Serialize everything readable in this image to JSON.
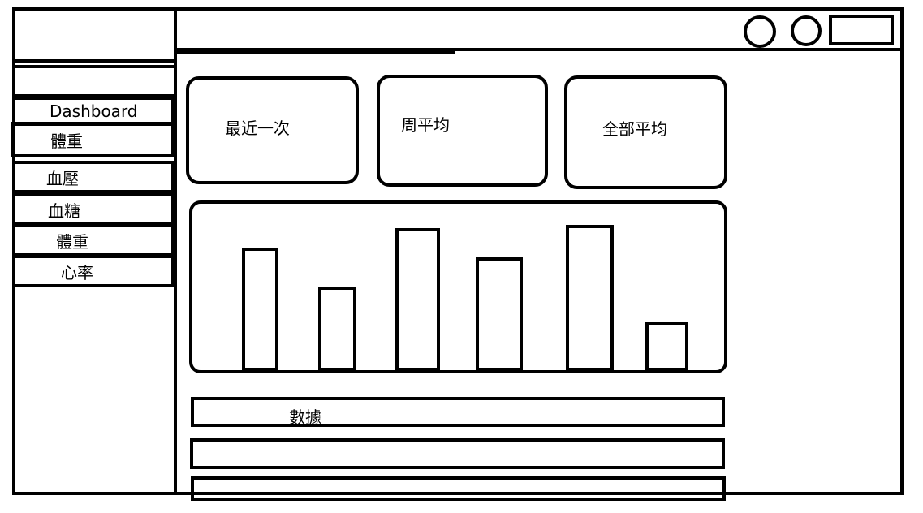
{
  "sidebar": {
    "items": [
      {
        "label": "Dashboard"
      },
      {
        "label": "體重"
      },
      {
        "label": "血壓"
      },
      {
        "label": "血糖"
      },
      {
        "label": "體重"
      },
      {
        "label": "心率"
      }
    ]
  },
  "cards": [
    {
      "label": "最近一次"
    },
    {
      "label": "周平均"
    },
    {
      "label": "全部平均"
    }
  ],
  "chart_data": {
    "type": "bar",
    "values": [
      76,
      52,
      88,
      70,
      90,
      30
    ],
    "ylim": [
      0,
      100
    ]
  },
  "table": {
    "header": "數據"
  }
}
